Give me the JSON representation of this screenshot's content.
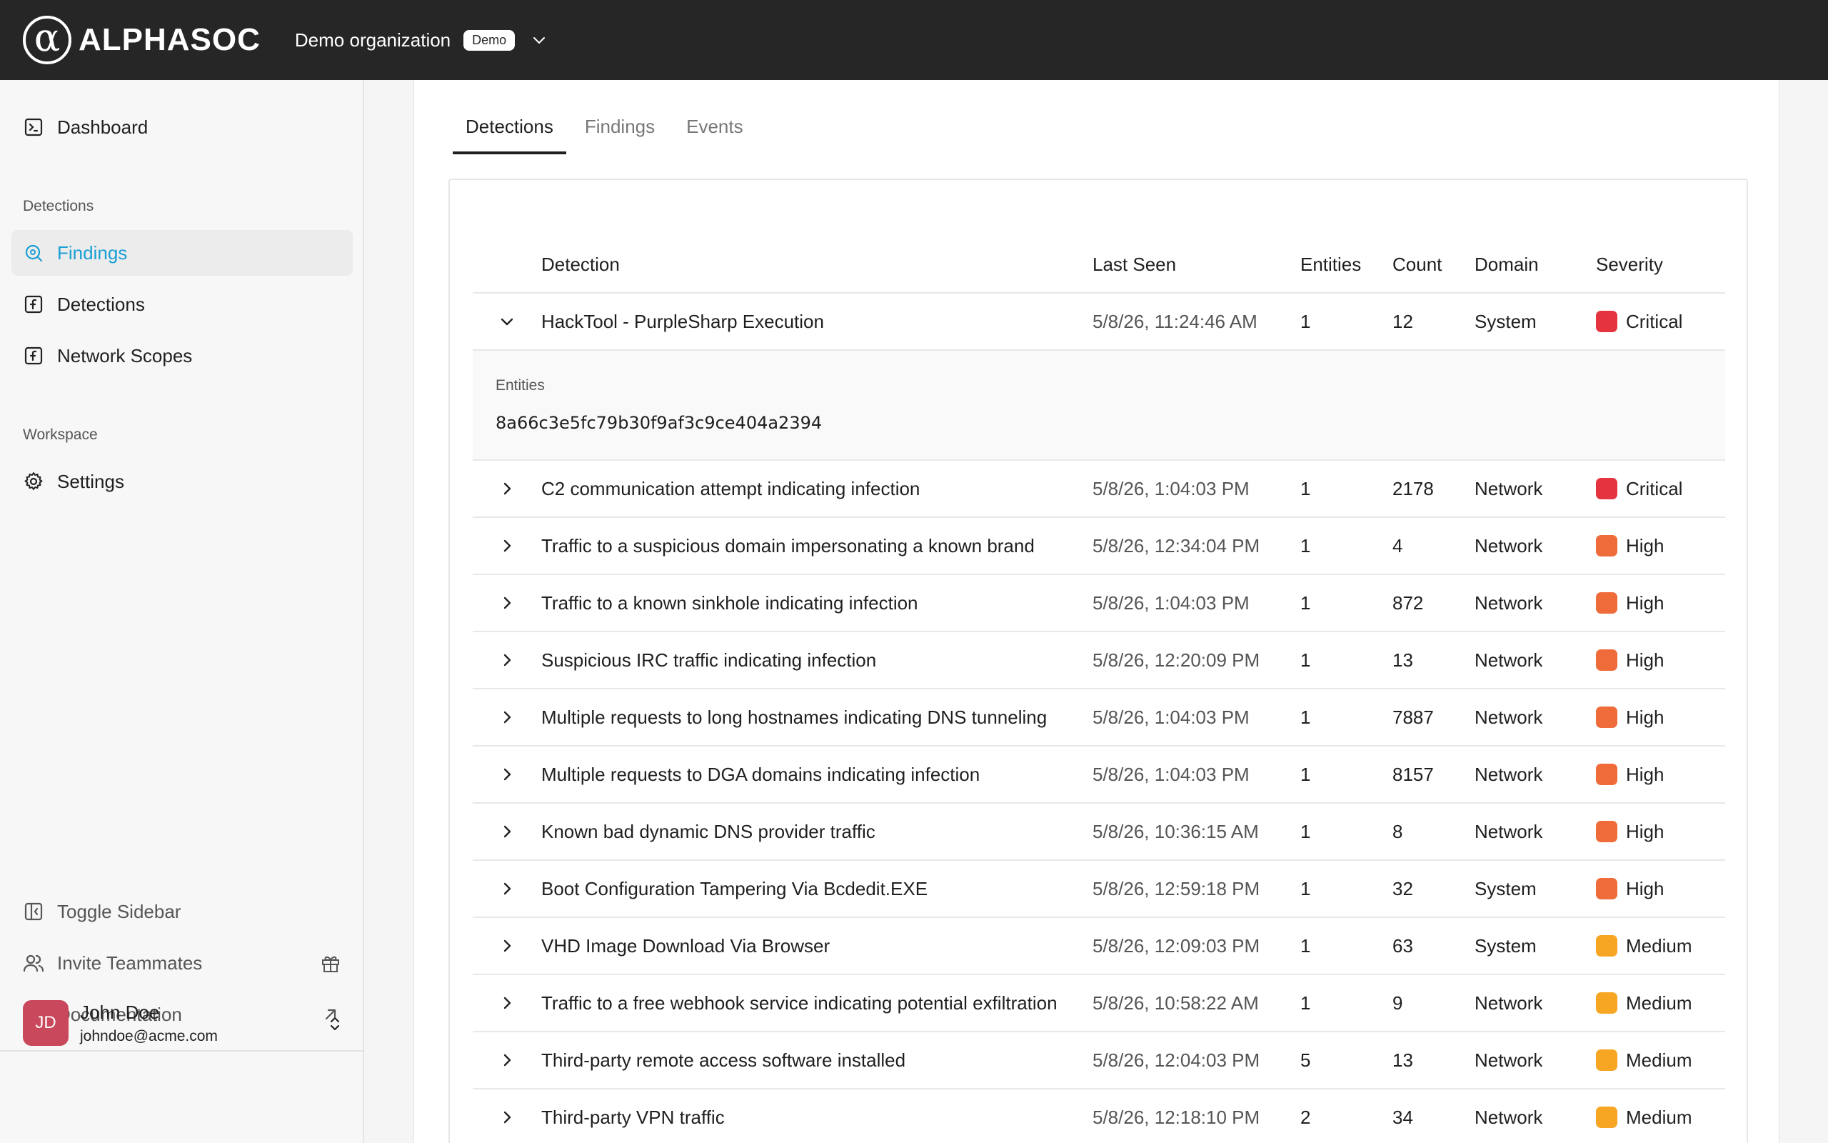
{
  "brand": {
    "name": "ALPHASOC",
    "mark": "α"
  },
  "org": {
    "name": "Demo organization",
    "badge": "Demo"
  },
  "sidebar": {
    "dashboard": "Dashboard",
    "detections_section": "Detections",
    "findings": "Findings",
    "detections": "Detections",
    "network_scopes": "Network Scopes",
    "workspace_section": "Workspace",
    "settings": "Settings",
    "toggle_sidebar": "Toggle Sidebar",
    "invite_teammates": "Invite Teammates",
    "documentation": "Documentation"
  },
  "user": {
    "initials": "JD",
    "name": "John Doe",
    "email": "johndoe@acme.com"
  },
  "tabs": [
    "Detections",
    "Findings",
    "Events"
  ],
  "table": {
    "headers": {
      "detection": "Detection",
      "last_seen": "Last Seen",
      "entities": "Entities",
      "count": "Count",
      "domain": "Domain",
      "severity": "Severity"
    },
    "expanded": {
      "label": "Entities",
      "value": "8a66c3e5fc79b30f9af3c9ce404a2394"
    },
    "rows": [
      {
        "detection": "HackTool - PurpleSharp Execution",
        "last_seen": "5/8/26, 11:24:46 AM",
        "entities": "1",
        "count": "12",
        "domain": "System",
        "severity": "Critical"
      },
      {
        "detection": "C2 communication attempt indicating infection",
        "last_seen": "5/8/26, 1:04:03 PM",
        "entities": "1",
        "count": "2178",
        "domain": "Network",
        "severity": "Critical"
      },
      {
        "detection": "Traffic to a suspicious domain impersonating a known brand",
        "last_seen": "5/8/26, 12:34:04 PM",
        "entities": "1",
        "count": "4",
        "domain": "Network",
        "severity": "High"
      },
      {
        "detection": "Traffic to a known sinkhole indicating infection",
        "last_seen": "5/8/26, 1:04:03 PM",
        "entities": "1",
        "count": "872",
        "domain": "Network",
        "severity": "High"
      },
      {
        "detection": "Suspicious IRC traffic indicating infection",
        "last_seen": "5/8/26, 12:20:09 PM",
        "entities": "1",
        "count": "13",
        "domain": "Network",
        "severity": "High"
      },
      {
        "detection": "Multiple requests to long hostnames indicating DNS tunneling",
        "last_seen": "5/8/26, 1:04:03 PM",
        "entities": "1",
        "count": "7887",
        "domain": "Network",
        "severity": "High"
      },
      {
        "detection": "Multiple requests to DGA domains indicating infection",
        "last_seen": "5/8/26, 1:04:03 PM",
        "entities": "1",
        "count": "8157",
        "domain": "Network",
        "severity": "High"
      },
      {
        "detection": "Known bad dynamic DNS provider traffic",
        "last_seen": "5/8/26, 10:36:15 AM",
        "entities": "1",
        "count": "8",
        "domain": "Network",
        "severity": "High"
      },
      {
        "detection": "Boot Configuration Tampering Via Bcdedit.EXE",
        "last_seen": "5/8/26, 12:59:18 PM",
        "entities": "1",
        "count": "32",
        "domain": "System",
        "severity": "High"
      },
      {
        "detection": "VHD Image Download Via Browser",
        "last_seen": "5/8/26, 12:09:03 PM",
        "entities": "1",
        "count": "63",
        "domain": "System",
        "severity": "Medium"
      },
      {
        "detection": "Traffic to a free webhook service indicating potential exfiltration",
        "last_seen": "5/8/26, 10:58:22 AM",
        "entities": "1",
        "count": "9",
        "domain": "Network",
        "severity": "Medium"
      },
      {
        "detection": "Third-party remote access software installed",
        "last_seen": "5/8/26, 12:04:03 PM",
        "entities": "5",
        "count": "13",
        "domain": "Network",
        "severity": "Medium"
      },
      {
        "detection": "Third-party VPN traffic",
        "last_seen": "5/8/26, 12:18:10 PM",
        "entities": "2",
        "count": "34",
        "domain": "Network",
        "severity": "Medium"
      }
    ]
  },
  "severity_colors": {
    "Critical": "#e5343f",
    "High": "#ef6b3a",
    "Medium": "#f6a623"
  },
  "colors": {
    "accent": "#1a9fd4",
    "topbar": "#262626",
    "avatar": "#c9485b"
  }
}
